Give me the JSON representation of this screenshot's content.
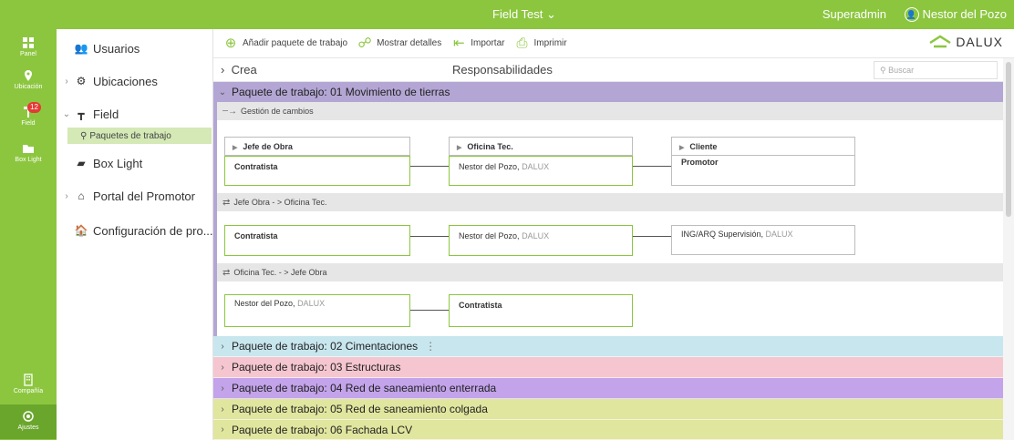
{
  "topbar": {
    "project": "Field Test ⌄",
    "role": "Superadmin",
    "user": "Nestor del Pozo",
    "color": "#8cc63f"
  },
  "rail": {
    "items": [
      {
        "label": "Panel",
        "icon": "grid-icon"
      },
      {
        "label": "Ubicación",
        "icon": "location-pin-icon"
      },
      {
        "label": "Field",
        "icon": "field-tool-icon",
        "badge": "12"
      },
      {
        "label": "Box Light",
        "icon": "folder-icon"
      },
      {
        "label": "Compañía",
        "icon": "building-icon"
      },
      {
        "label": "Ajustes",
        "icon": "gear-icon"
      }
    ]
  },
  "sidebar": {
    "items": [
      {
        "label": "Usuarios",
        "icon": "users-icon"
      },
      {
        "label": "Ubicaciones",
        "icon": "locations-icon"
      },
      {
        "label": "Field",
        "icon": "field-icon"
      },
      {
        "label": "Box Light",
        "icon": "box-light-icon"
      },
      {
        "label": "Portal del Promotor",
        "icon": "portal-icon"
      },
      {
        "label": "Configuración de pro...",
        "icon": "home-icon"
      }
    ],
    "sub_item": "Paquetes de trabajo"
  },
  "toolbar": {
    "add": "Añadir paquete de trabajo",
    "details": "Mostrar detalles",
    "import": "Importar",
    "print": "Imprimir",
    "logo": "DALUX"
  },
  "header": {
    "crea": "Crea",
    "responsabilidades": "Responsabilidades",
    "search_placeholder": "Buscar"
  },
  "open_package": {
    "title": "Paquete de trabajo: 01 Movimiento de tierras",
    "sections": [
      {
        "title": "Gestión de cambios",
        "headers": [
          "Jefe de Obra",
          "Oficina Tec.",
          "Cliente"
        ],
        "cells": [
          {
            "name": "Contratista",
            "company": ""
          },
          {
            "name": "Nestor del Pozo,",
            "company": "DALUX"
          },
          {
            "name": "Promotor",
            "company": ""
          }
        ]
      },
      {
        "title": "Jefe Obra - > Oficina Tec.",
        "cells": [
          {
            "name": "Contratista",
            "company": ""
          },
          {
            "name": "Nestor del Pozo,",
            "company": "DALUX"
          },
          {
            "name": "ING/ARQ Supervisión,",
            "company": "DALUX"
          }
        ]
      },
      {
        "title": "Oficina Tec. - > Jefe Obra",
        "cells": [
          {
            "name": "Nestor del Pozo,",
            "company": "DALUX"
          },
          {
            "name": "Contratista",
            "company": ""
          }
        ]
      }
    ]
  },
  "packages": [
    {
      "title": "Paquete de trabajo: 02 Cimentaciones",
      "color": "#c8e6ee",
      "dots": "⋮"
    },
    {
      "title": "Paquete de trabajo: 03 Estructuras",
      "color": "#f5c6cf",
      "dots": ""
    },
    {
      "title": "Paquete de trabajo: 04 Red de saneamiento enterrada",
      "color": "#c3a3ea",
      "dots": ""
    },
    {
      "title": "Paquete de trabajo: 05 Red de saneamiento colgada",
      "color": "#e1e69f",
      "dots": ""
    },
    {
      "title": "Paquete de trabajo: 06 Fachada LCV",
      "color": "#e1e69f",
      "dots": ""
    }
  ]
}
